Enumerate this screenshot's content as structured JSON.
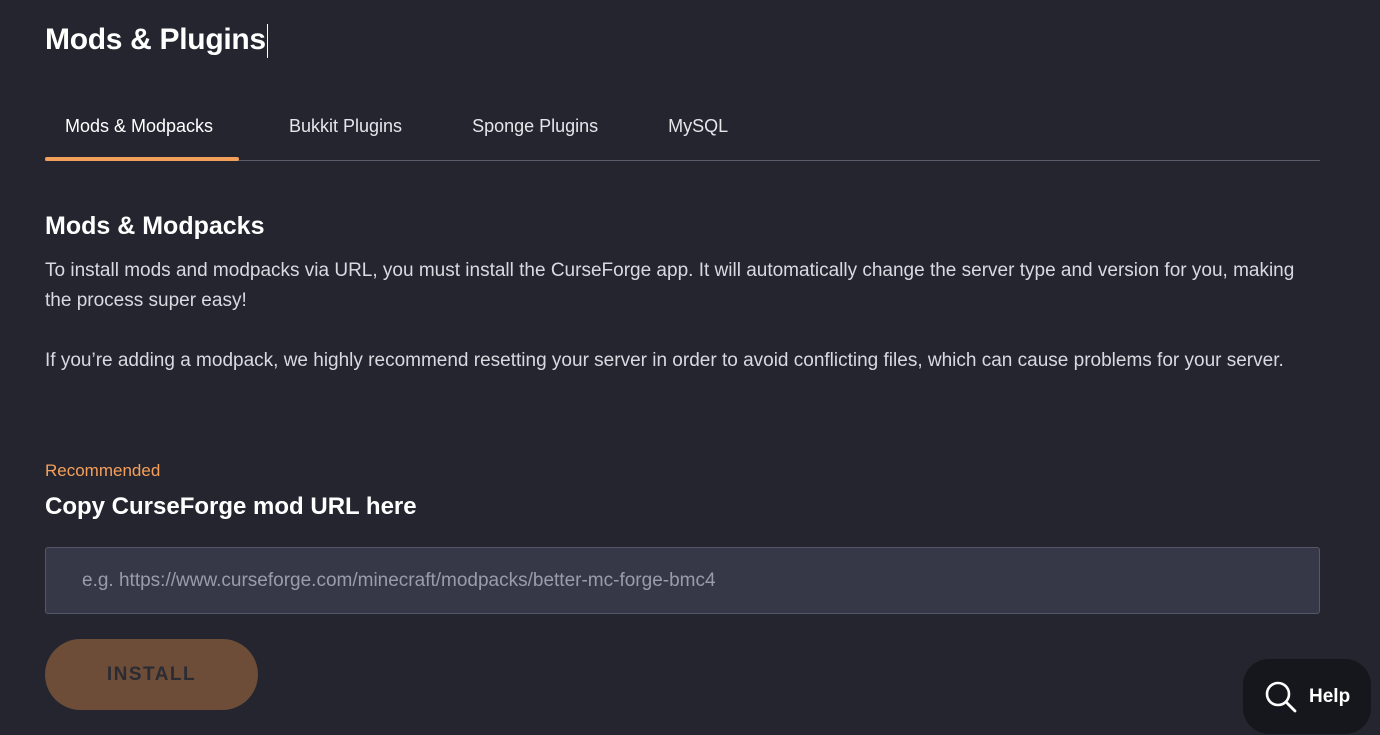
{
  "page": {
    "title": "Mods & Plugins"
  },
  "tabs": [
    {
      "label": "Mods & Modpacks",
      "active": true
    },
    {
      "label": "Bukkit Plugins",
      "active": false
    },
    {
      "label": "Sponge Plugins",
      "active": false
    },
    {
      "label": "MySQL",
      "active": false
    }
  ],
  "section": {
    "title": "Mods & Modpacks",
    "paragraph_1": "To install mods and modpacks via URL, you must install the CurseForge app. It will automatically change the server type and version for you, making the process super easy!",
    "paragraph_2": "If you’re adding a modpack, we highly recommend resetting your server in order to avoid conflicting files, which can cause problems for your server."
  },
  "mod_url": {
    "badge": "Recommended",
    "label": "Copy CurseForge mod URL here",
    "value": "",
    "placeholder": "e.g. https://www.curseforge.com/minecraft/modpacks/better-mc-forge-bmc4"
  },
  "install_button": {
    "label": "INSTALL",
    "enabled": false
  },
  "help": {
    "label": "Help",
    "icon": "search-icon"
  },
  "colors": {
    "background": "#24252f",
    "accent": "#f5a05a",
    "input_background": "#363847",
    "install_button_disabled": "#6d4d37",
    "help_background": "#16171c"
  }
}
